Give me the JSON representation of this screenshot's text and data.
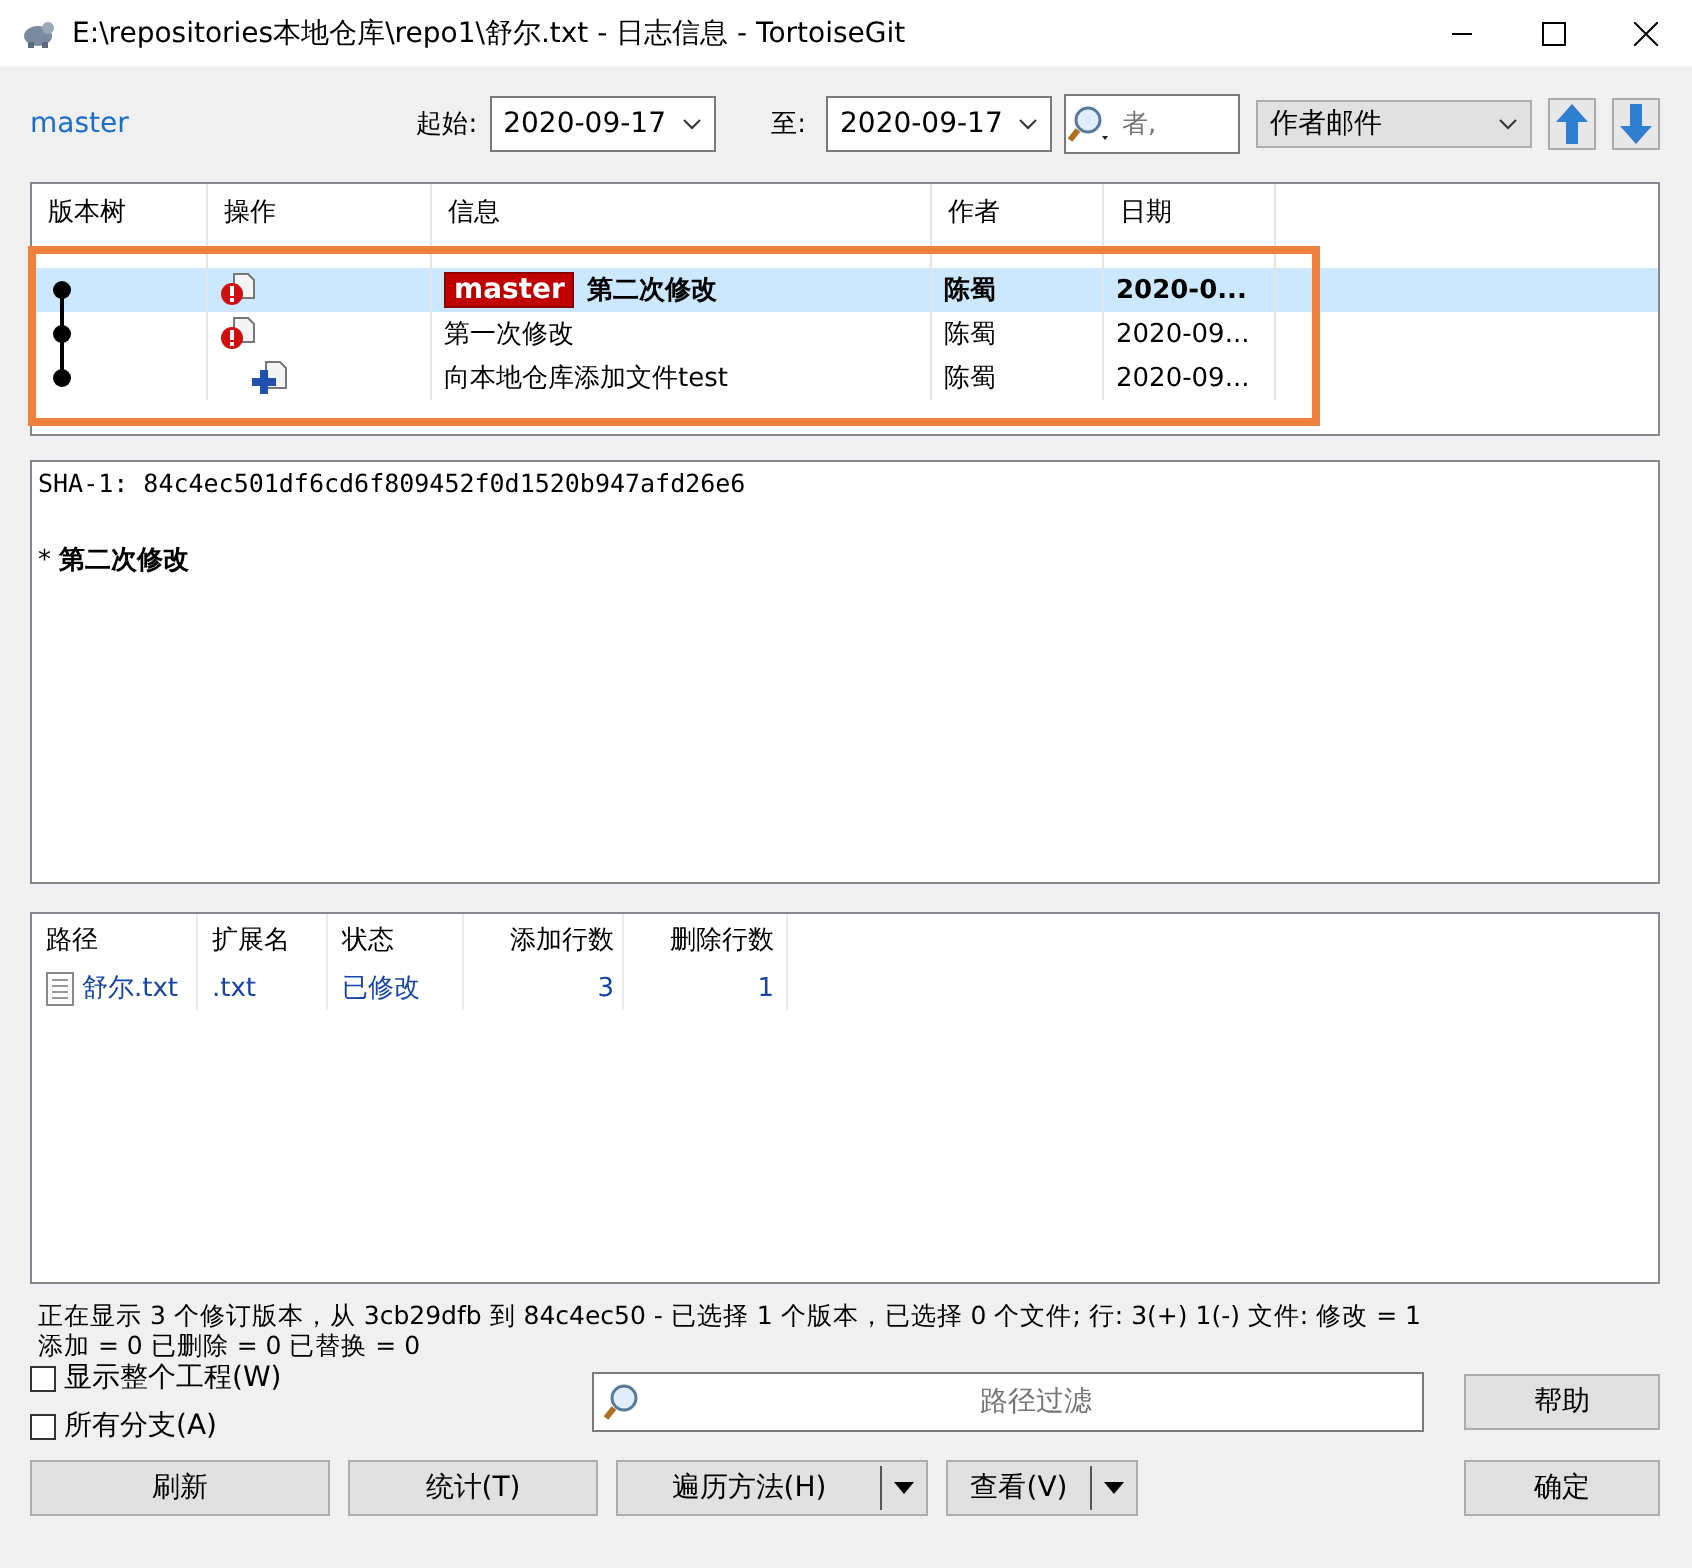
{
  "window": {
    "title": "E:\\repositories本地仓库\\repo1\\舒尔.txt - 日志信息 - TortoiseGit"
  },
  "toolbar": {
    "branch": "master",
    "from_label": "起始:",
    "from_date": "2020-09-17",
    "to_label": "至:",
    "to_date": "2020-09-17",
    "search_placeholder": "者,",
    "filter_field": "作者邮件"
  },
  "log": {
    "columns": [
      "版本树",
      "操作",
      "信息",
      "作者",
      "日期"
    ],
    "rows": [
      {
        "kind": "modified",
        "ref": "master",
        "message": "第二次修改",
        "author": "陈蜀",
        "date": "2020-0...",
        "selected": true
      },
      {
        "kind": "modified",
        "ref": "",
        "message": "第一次修改",
        "author": "陈蜀",
        "date": "2020-09...",
        "selected": false
      },
      {
        "kind": "added",
        "ref": "",
        "message": "向本地仓库添加文件test",
        "author": "陈蜀",
        "date": "2020-09...",
        "selected": false
      }
    ]
  },
  "message": {
    "sha": "SHA-1: 84c4ec501df6cd6f809452f0d1520b947afd26e6",
    "subject": "* **第二次修改**"
  },
  "files": {
    "columns": [
      "路径",
      "扩展名",
      "状态",
      "添加行数",
      "删除行数"
    ],
    "rows": [
      {
        "path": "舒尔.txt",
        "ext": ".txt",
        "status": "已修改",
        "added": "3",
        "removed": "1"
      }
    ]
  },
  "status": [
    "正在显示 3 个修订版本，从 3cb29dfb 到 84c4ec50 - 已选择 1 个版本，已选择 0 个文件; 行: 3(+) 1(-) 文件: 修改 = 1",
    "添加 = 0 已删除 = 0 已替换 = 0"
  ],
  "checkboxes": [
    {
      "label": "显示整个工程(W)",
      "checked": false
    },
    {
      "label": "所有分支(A)",
      "checked": false
    }
  ],
  "path_filter": {
    "placeholder": "路径过滤"
  },
  "buttons": [
    {
      "label": "帮助",
      "kind": "plain"
    },
    {
      "label": "刷新",
      "kind": "plain"
    },
    {
      "label": "统计(T)",
      "kind": "plain"
    },
    {
      "label": "遍历方法(H)",
      "kind": "split"
    },
    {
      "label": "查看(V)",
      "kind": "split"
    },
    {
      "label": "确定",
      "kind": "plain"
    }
  ]
}
